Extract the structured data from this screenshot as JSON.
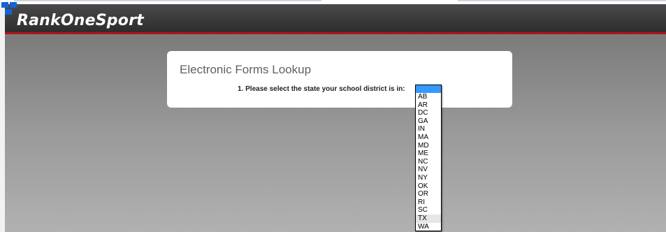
{
  "header": {
    "logo_text": "RankOneSport",
    "colors": {
      "bar": "#333333",
      "accent_line": "#b01318",
      "logo_mark": "#1463d6"
    }
  },
  "card": {
    "title": "Electronic Forms Lookup",
    "prompt": "1. Please select the state your school district is in:"
  },
  "state_select": {
    "selected": "",
    "highlighted": "TX",
    "options": [
      "AB",
      "AR",
      "DC",
      "GA",
      "IN",
      "MA",
      "MD",
      "ME",
      "NC",
      "NV",
      "NY",
      "OK",
      "OR",
      "RI",
      "SC",
      "TX",
      "WA"
    ]
  }
}
